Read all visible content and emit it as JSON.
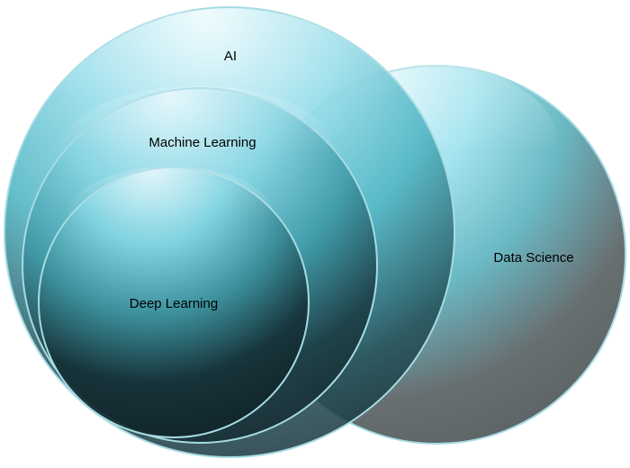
{
  "diagram": {
    "type": "nested-venn",
    "colors": {
      "highlight": "#dff6fb",
      "mid": "#6fd3e4",
      "deep": "#2f7f8a",
      "shadow": "#122a30",
      "data_science_shadow": "#5c6466",
      "rim": "#a6dbe3"
    },
    "circles": [
      {
        "id": "data-science",
        "label": "Data Science"
      },
      {
        "id": "ai",
        "label": "AI"
      },
      {
        "id": "machine-learning",
        "label": "Machine Learning"
      },
      {
        "id": "deep-learning",
        "label": "Deep Learning"
      }
    ]
  }
}
